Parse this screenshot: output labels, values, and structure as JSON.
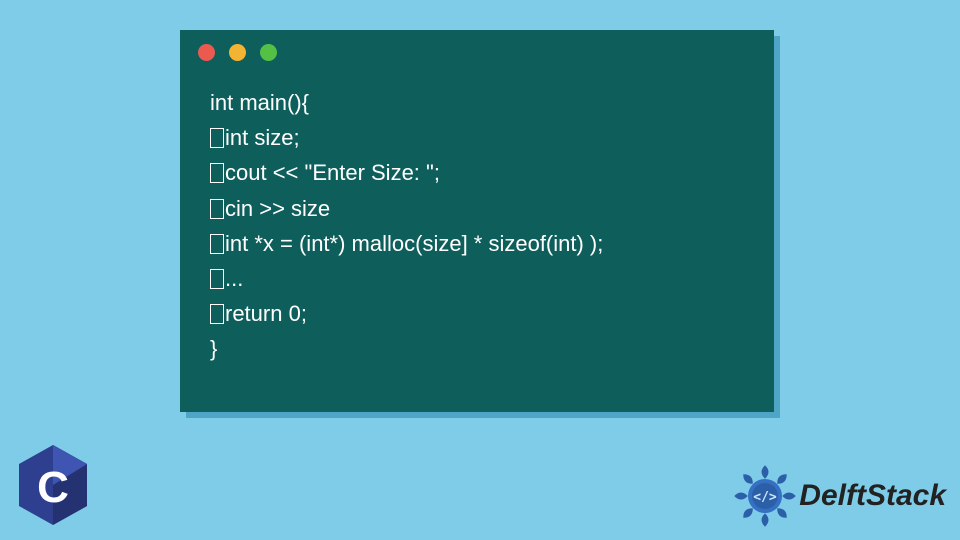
{
  "window": {
    "dots": {
      "red": "#ec5a4f",
      "yellow": "#f4b433",
      "green": "#54c145"
    }
  },
  "code": {
    "l0": "int main(){",
    "l1": "int size;",
    "l2": "cout << \"Enter Size: \";",
    "l3": "cin >> size",
    "l4": "int *x = (int*) malloc(size] * sizeof(int) );",
    "l5": "...",
    "l6": "return 0;",
    "l7": "}"
  },
  "lang_logo": {
    "letter": "C"
  },
  "brand": {
    "name": "DelftStack",
    "badge_symbol": "</>"
  }
}
